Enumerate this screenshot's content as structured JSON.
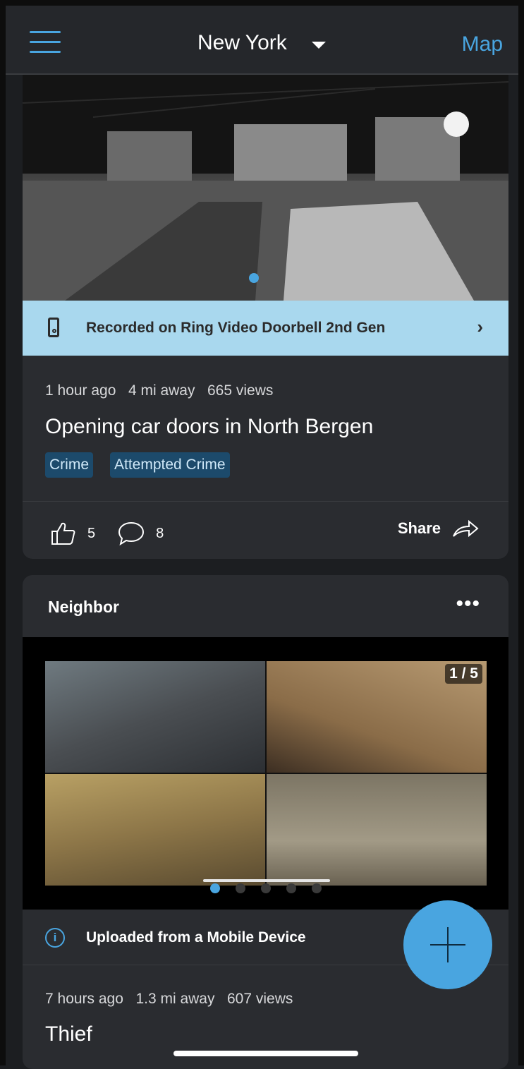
{
  "header": {
    "city": "New York",
    "map_label": "Map"
  },
  "post1": {
    "device_label": "Recorded on Ring Video Doorbell 2nd Gen",
    "time": "1 hour ago",
    "distance": "4 mi away",
    "views": "665 views",
    "title": "Opening car doors in North Bergen",
    "tags": [
      "Crime",
      "Attempted Crime"
    ],
    "likes": "5",
    "comments": "8",
    "share_label": "Share"
  },
  "post2": {
    "author": "Neighbor",
    "more_label": "•••",
    "counter": "1 / 5",
    "upload_label": "Uploaded from a Mobile Device",
    "time": "7 hours ago",
    "distance": "1.3 mi away",
    "views": "607 views",
    "title": "Thief"
  },
  "colors": {
    "accent": "#49a5e0",
    "background": "#1c1e21",
    "card": "#2a2c30",
    "device_bar": "#a9d8ee",
    "tag_bg": "#1c4a6b"
  }
}
